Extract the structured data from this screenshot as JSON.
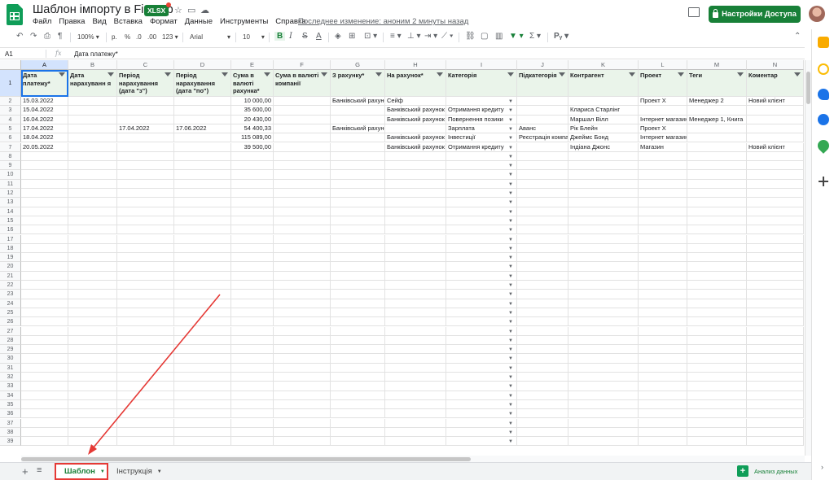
{
  "header": {
    "title": "Шаблон імпорту в Finmap",
    "badge": "XLSX",
    "last_edit": "Последнее изменение: аноним 2 минуты назад",
    "share_label": "Настройки Доступа",
    "menu": [
      "Файл",
      "Правка",
      "Вид",
      "Вставка",
      "Формат",
      "Данные",
      "Инструменты",
      "Справка"
    ]
  },
  "toolbar": {
    "zoom": "100%",
    "currency": "р.",
    "percent": "%",
    "dec_less": ".0",
    "dec_more": ".00",
    "more_formats": "123",
    "font": "Arial",
    "size": "10",
    "bold": "B"
  },
  "formula_bar": {
    "cell_ref": "A1",
    "fx": "fx",
    "value": "Дата платежу*"
  },
  "grid": {
    "columns": [
      "A",
      "B",
      "C",
      "D",
      "E",
      "F",
      "G",
      "H",
      "I",
      "J",
      "K",
      "L",
      "M",
      "N"
    ],
    "headers": [
      "Дата платежу*",
      "Дата нарахуванн я",
      "Період нарахування (дата \"з\")",
      "Період нарахування (дата \"по\")",
      "Сума в валюті рахунка*",
      "Сума в валюті компанії",
      "З рахунку*",
      "На рахунок*",
      "Категорія",
      "Підкатегорія",
      "Контрагент",
      "Проект",
      "Теги",
      "Коментар"
    ],
    "rows": [
      [
        "15.03.2022",
        "",
        "",
        "",
        "10 000,00",
        "",
        "Банківський рахунок",
        "Сейф",
        "",
        "",
        "",
        "Проект X",
        "Менеджер 2",
        "Новий клієнт"
      ],
      [
        "15.04.2022",
        "",
        "",
        "",
        "35 600,00",
        "",
        "",
        "Банківський рахунок",
        "Отримання кредиту",
        "",
        "Клариса Старлінг",
        "",
        "",
        ""
      ],
      [
        "16.04.2022",
        "",
        "",
        "",
        "20 430,00",
        "",
        "",
        "Банківський рахунок",
        "Повернення позики",
        "",
        "Маршал Вілл",
        "Інтернет магазин",
        "Менеджер 1, Книга",
        ""
      ],
      [
        "17.04.2022",
        "",
        "17.04.2022",
        "17.06.2022",
        "54 400,33",
        "",
        "Банківський рахунок",
        "",
        "Зарплата",
        "Аванс",
        "Рік Блейн",
        "Проект X",
        "",
        ""
      ],
      [
        "18.04.2022",
        "",
        "",
        "",
        "115 089,00",
        "",
        "",
        "Банківський рахунок",
        "Інвестиції",
        "Реєстрація компанії",
        "Джеймс Бонд",
        "Інтернет магазин",
        "",
        ""
      ],
      [
        "20.05.2022",
        "",
        "",
        "",
        "39 500,00",
        "",
        "",
        "Банківський рахунок",
        "Отримання кредиту",
        "",
        "Індіана Джонс",
        "Магазин",
        "",
        "Новий клієнт"
      ]
    ],
    "row_numbers": [
      "1",
      "2",
      "3",
      "4",
      "5",
      "6",
      "7",
      "8",
      "9",
      "10",
      "11",
      "12",
      "13",
      "14",
      "15",
      "16",
      "17",
      "18",
      "19",
      "20",
      "21",
      "22",
      "23",
      "24",
      "25",
      "26",
      "27",
      "28",
      "29",
      "30",
      "31",
      "32",
      "33",
      "34",
      "35",
      "36",
      "37",
      "38",
      "39"
    ]
  },
  "sheet_tabs": {
    "add": "+",
    "list": "≡",
    "tabs": [
      "Шаблон",
      "Інструкція"
    ],
    "explore": "Анализ данных"
  },
  "colors": {
    "accent_green": "#188038",
    "selection": "#1a73e8",
    "annotation": "#e53935",
    "header_fill": "#eaf4ea"
  },
  "icons": [
    "undo-icon",
    "redo-icon",
    "print-icon",
    "paint-format-icon",
    "star-icon",
    "folder-icon",
    "cloud-icon",
    "comment-icon",
    "lock-icon",
    "filter-icon",
    "sigma-icon",
    "plus-icon",
    "explore-icon"
  ]
}
